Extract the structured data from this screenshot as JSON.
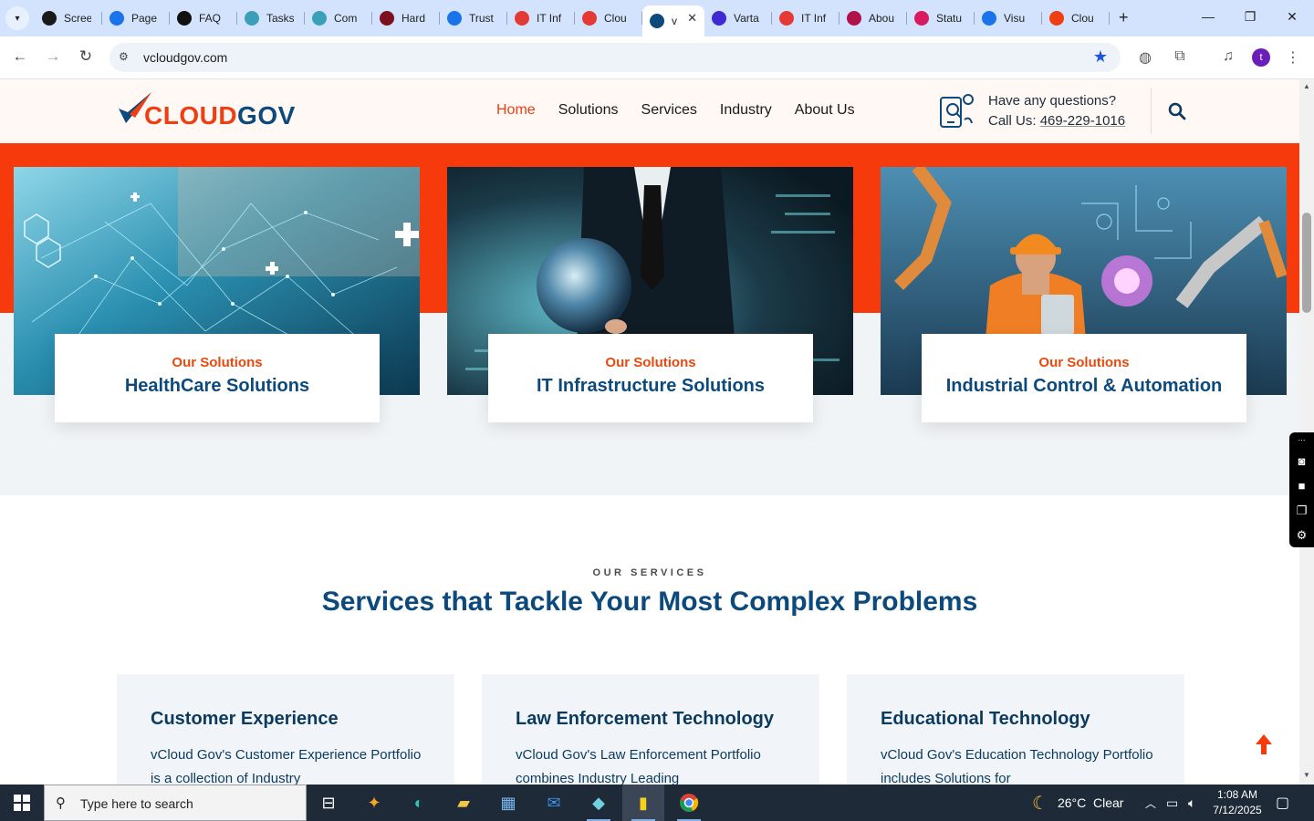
{
  "browser": {
    "tabs": [
      {
        "label": "Scree",
        "icon": "camera-lens-icon",
        "color": "#1a1a1a"
      },
      {
        "label": "Page",
        "icon": "speedometer-icon",
        "color": "#1a73e8"
      },
      {
        "label": "FAQ",
        "icon": "openai-icon",
        "color": "#111111"
      },
      {
        "label": "Tasks",
        "icon": "clickup-icon",
        "color": "#3aa0b8"
      },
      {
        "label": "Com",
        "icon": "clickup-icon",
        "color": "#3aa0b8"
      },
      {
        "label": "Hard",
        "icon": "v-logo-icon",
        "color": "#7a1020"
      },
      {
        "label": "Trust",
        "icon": "scales-icon",
        "color": "#1a73e8"
      },
      {
        "label": "IT Inf",
        "icon": "shield-logo-icon",
        "color": "#e53935"
      },
      {
        "label": "Clou",
        "icon": "shield-logo-icon",
        "color": "#e53935"
      },
      {
        "label": "v",
        "icon": "cloudgov-icon",
        "color": "#0c4a7d",
        "active": true
      },
      {
        "label": "Varta",
        "icon": "x-logo-icon",
        "color": "#3b2bd0"
      },
      {
        "label": "IT Inf",
        "icon": "shield-logo-icon",
        "color": "#e53935"
      },
      {
        "label": "Abou",
        "icon": "flower-logo-icon",
        "color": "#b0124a"
      },
      {
        "label": "Statu",
        "icon": "feather-logo-icon",
        "color": "#d81b60"
      },
      {
        "label": "Visu",
        "icon": "pulse-icon",
        "color": "#1a73e8"
      },
      {
        "label": "Clou",
        "icon": "swoosh-logo-icon",
        "color": "#ef3e12"
      }
    ],
    "url": "vcloudgov.com",
    "profile_initial": "t"
  },
  "site": {
    "logo": {
      "part1": "CLOUD",
      "part2": "GOV",
      "accent": "#ef3e12",
      "brand": "#0c4a7d"
    },
    "nav": [
      "Home",
      "Solutions",
      "Services",
      "Industry",
      "About Us"
    ],
    "contact": {
      "question": "Have any questions?",
      "call_prefix": "Call Us: ",
      "phone": "469-229-1016"
    },
    "solutions": [
      {
        "eyebrow": "Our Solutions",
        "title": "HealthCare Solutions"
      },
      {
        "eyebrow": "Our Solutions",
        "title": "IT Infrastructure Solutions"
      },
      {
        "eyebrow": "Our Solutions",
        "title": "Industrial Control & Automation"
      }
    ],
    "services": {
      "eyebrow": "OUR SERVICES",
      "title": "Services that Tackle Your Most Complex Problems",
      "items": [
        {
          "title": "Customer Experience",
          "desc": "vCloud Gov's Customer Experience Portfolio is a collection of Industry"
        },
        {
          "title": "Law Enforcement Technology",
          "desc": "vCloud Gov's Law Enforcement Portfolio combines Industry Leading"
        },
        {
          "title": "Educational Technology",
          "desc": "vCloud Gov's Education Technology Portfolio includes Solutions for"
        }
      ]
    }
  },
  "taskbar": {
    "search_placeholder": "Type here to search",
    "weather": "26°C  Clear",
    "time": "1:08 AM",
    "date": "7/12/2025"
  }
}
